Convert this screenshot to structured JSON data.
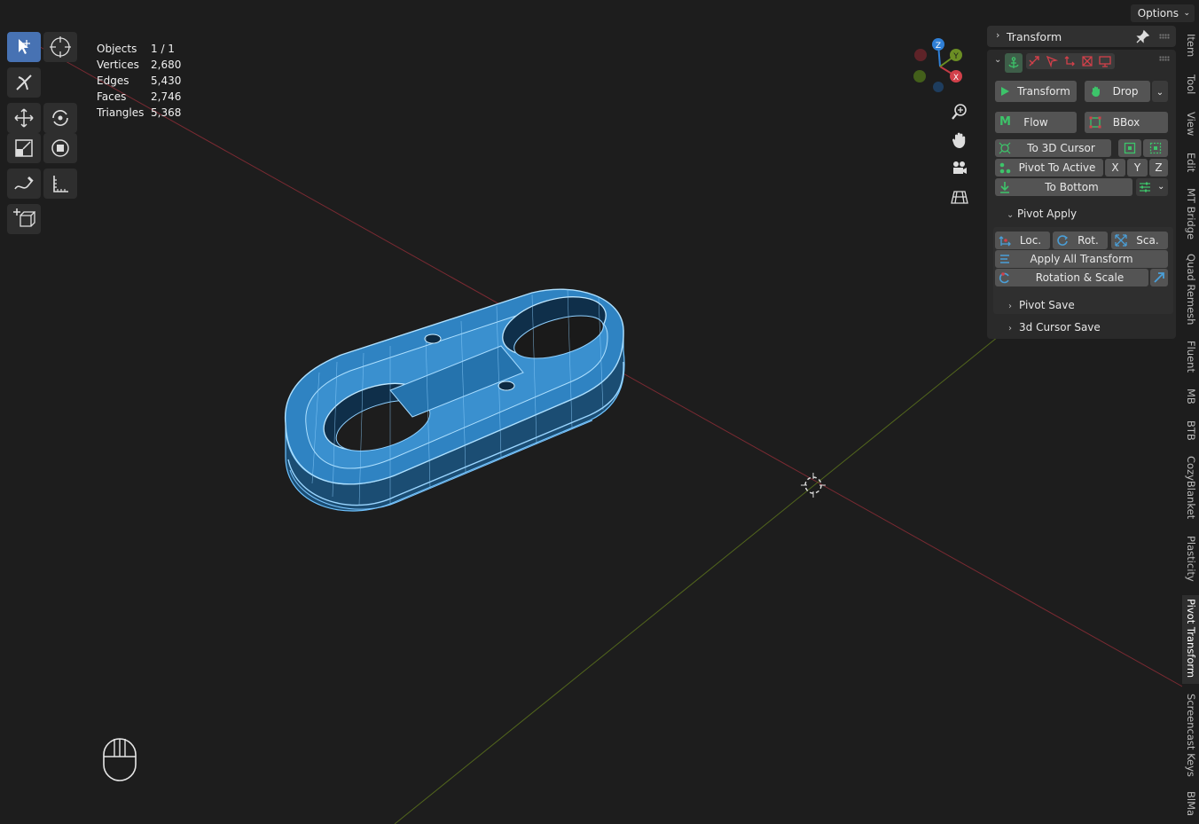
{
  "header": {
    "options_label": "Options"
  },
  "stats": [
    {
      "label": "Objects",
      "value": "1 / 1"
    },
    {
      "label": "Vertices",
      "value": "2,680"
    },
    {
      "label": "Edges",
      "value": "5,430"
    },
    {
      "label": "Faces",
      "value": "2,746"
    },
    {
      "label": "Triangles",
      "value": "5,368"
    }
  ],
  "gizmo": {
    "x": "X",
    "y": "Y",
    "z": "Z"
  },
  "panel": {
    "title": "Transform",
    "buttons": {
      "transform": "Transform",
      "drop": "Drop",
      "flow": "Flow",
      "bbox": "BBox",
      "to_3d_cursor": "To 3D Cursor",
      "pivot_to_active": "Pivot To Active",
      "x": "X",
      "y": "Y",
      "z": "Z",
      "to_bottom": "To Bottom"
    },
    "pivot_apply": {
      "title": "Pivot Apply",
      "loc": "Loc.",
      "rot": "Rot.",
      "sca": "Sca.",
      "apply_all": "Apply All Transform",
      "rotation_scale": "Rotation & Scale"
    },
    "pivot_save": "Pivot Save",
    "cursor_save": "3d Cursor Save"
  },
  "tabs": [
    "Item",
    "Tool",
    "View",
    "Edit",
    "MT Bridge",
    "Quad Remesh",
    "Fluent",
    "MB",
    "BTB",
    "CozyBlanket",
    "Plasticity",
    "Pivot Transform",
    "Screencast Keys",
    "BlMa"
  ],
  "active_tab": "Pivot Transform",
  "colors": {
    "accent": "#4772b3",
    "mesh": "#4a9fd8",
    "x_axis": "#a8323c",
    "y_axis": "#6b8e23",
    "z_axis": "#2f7fd6",
    "green_icon": "#3dc46a",
    "red_icon": "#d2404a"
  }
}
